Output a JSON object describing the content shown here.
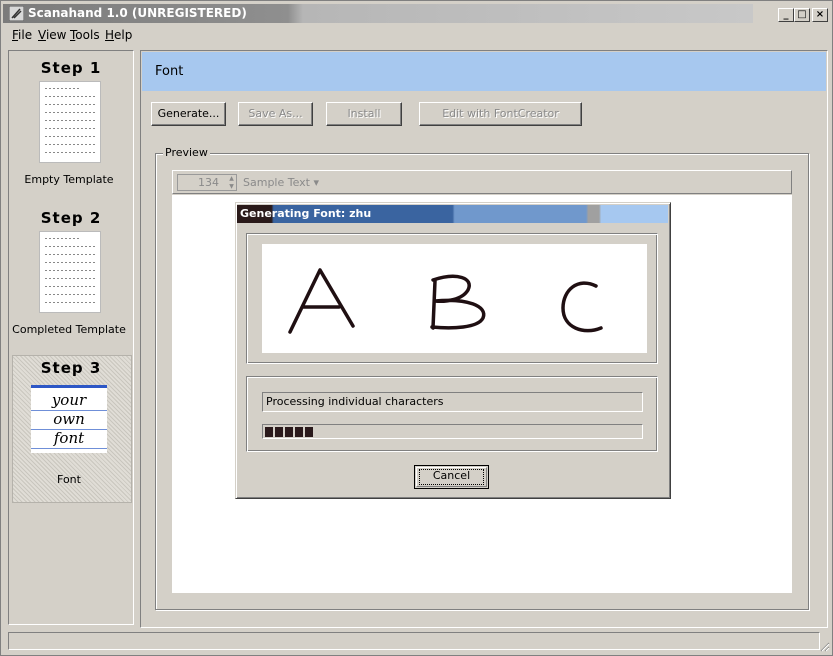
{
  "window": {
    "title": "Scanahand 1.0 (UNREGISTERED)",
    "controls": {
      "minimize": "_",
      "maximize": "□",
      "close": "×"
    }
  },
  "menu": [
    {
      "label": "File",
      "accel": "F",
      "rest": "ile"
    },
    {
      "label": "View",
      "accel": "V",
      "rest": "iew"
    },
    {
      "label": "Tools",
      "accel": "T",
      "rest": "ools"
    },
    {
      "label": "Help",
      "accel": "H",
      "rest": "elp"
    }
  ],
  "steps": [
    {
      "title": "Step 1",
      "label": "Empty Template"
    },
    {
      "title": "Step 2",
      "label": "Completed Template"
    },
    {
      "title": "Step 3",
      "label": "Font",
      "thumb_words": [
        "your",
        "own",
        "font"
      ]
    }
  ],
  "header": {
    "title": "Font"
  },
  "toolbar": {
    "generate": "Generate...",
    "save_as": "Save As...",
    "install": "Install",
    "edit_fontcreator": "Edit with FontCreator"
  },
  "preview": {
    "group_label": "Preview",
    "size_value": "134",
    "sample_text_label": "Sample Text ▾"
  },
  "dialog": {
    "title": "Generating Font: zhu",
    "glyphs": [
      "A",
      "B",
      "C"
    ],
    "status": "Processing individual characters",
    "progress_percent": 13,
    "cancel": "Cancel"
  }
}
